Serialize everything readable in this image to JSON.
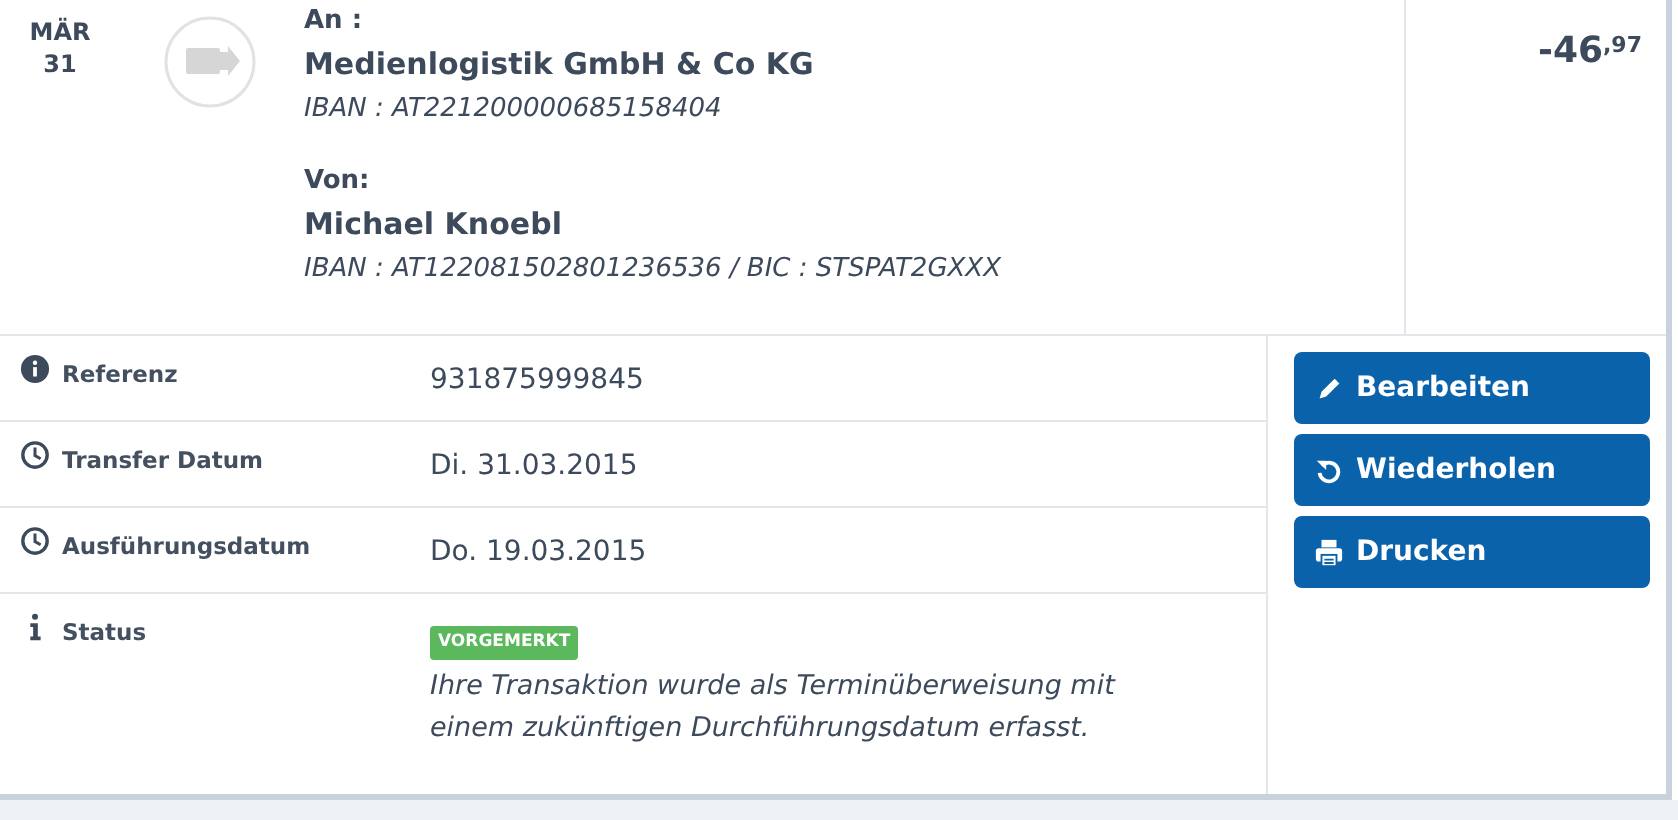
{
  "date": {
    "month": "MÄR",
    "day": "31"
  },
  "recipient": {
    "label": "An :",
    "name": "Medienlogistik GmbH & Co KG",
    "account": "IBAN : AT221200000685158404"
  },
  "sender": {
    "label": "Von:",
    "name": "Michael Knoebl",
    "account": "IBAN : AT122081502801236536 / BIC : STSPAT2GXXX"
  },
  "amount": "-46$^{,97}$",
  "details": [
    {
      "kind": "info-circle",
      "label": "Referenz",
      "value": "931875999845"
    },
    {
      "kind": "clock",
      "label": "Transfer Datum",
      "value": "Di. 31.03.2015"
    },
    {
      "kind": "clock",
      "label": "Ausführungsdatum",
      "value": "Do. 19.03.2015"
    },
    {
      "kind": "info",
      "label": "Status",
      "badge": "VORGEMERKT",
      "value": "Ihre Transaktion wurde als Terminüberweisung mit einem zukünftigen Durchführungsdatum erfasst."
    }
  ],
  "actions": [
    {
      "kind": "edit",
      "label": "Bearbeiten"
    },
    {
      "kind": "repeat",
      "label": "Wiederholen"
    },
    {
      "kind": "print",
      "label": "Drucken"
    }
  ]
}
